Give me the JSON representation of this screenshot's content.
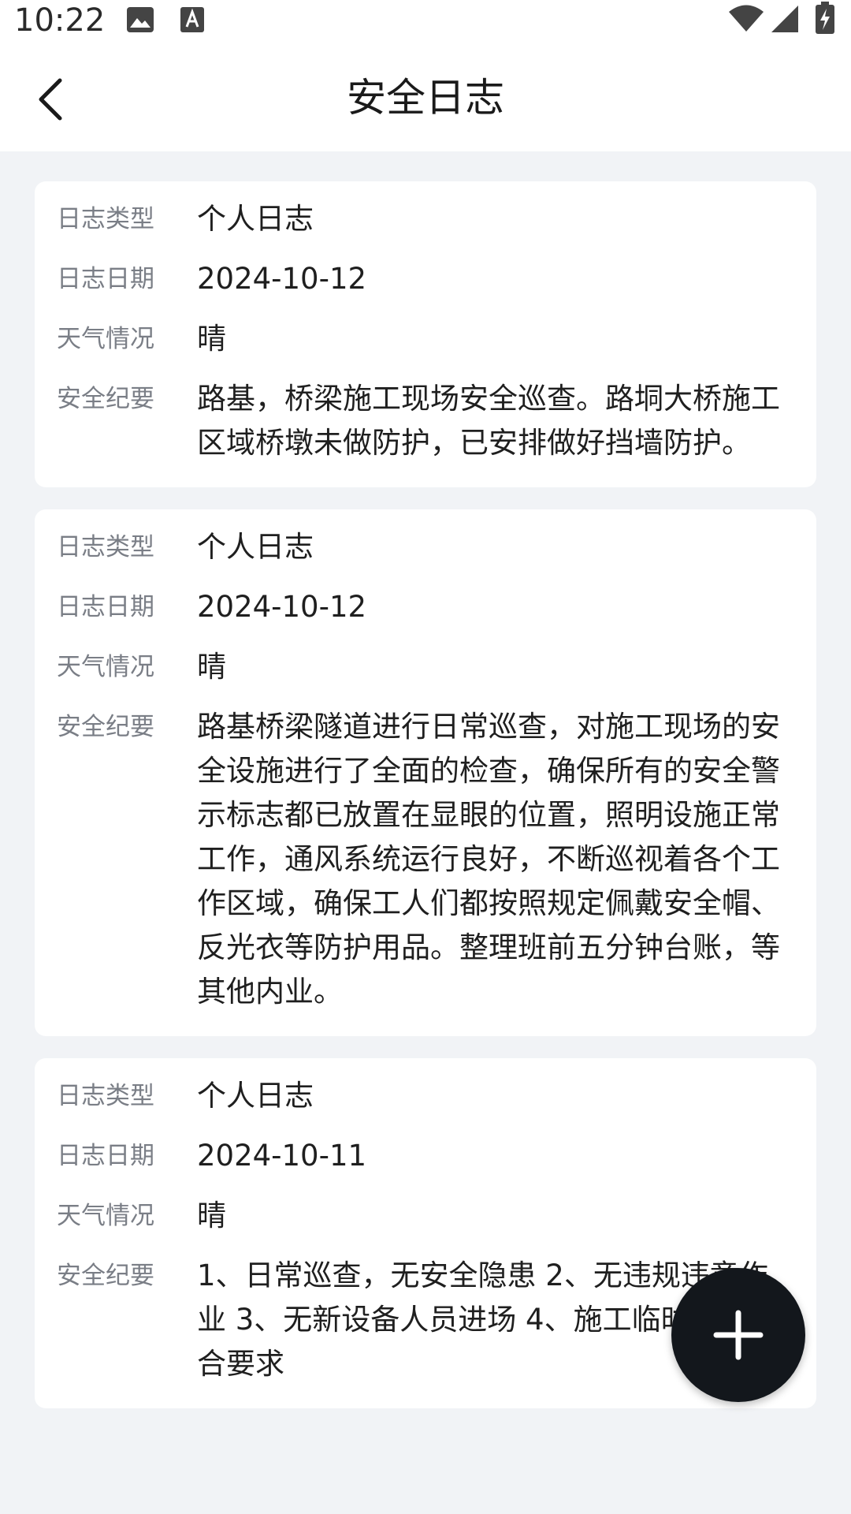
{
  "status_bar": {
    "time": "10:22",
    "icons_left": [
      "image-icon",
      "app-notification-icon"
    ],
    "icons_right": [
      "wifi-icon",
      "signal-icon",
      "battery-charging-icon"
    ]
  },
  "header": {
    "title": "安全日志",
    "back_icon": "chevron-left-icon"
  },
  "logs": [
    {
      "type_label": "日志类型",
      "type": "个人日志",
      "date_label": "日志日期",
      "date": "2024-10-12",
      "weather_label": "天气情况",
      "weather": "晴",
      "summary_label": "安全纪要",
      "summary": "路基，桥梁施工现场安全巡查。路垌大桥施工区域桥墩未做防护，已安排做好挡墙防护。"
    },
    {
      "type_label": "日志类型",
      "type": "个人日志",
      "date_label": "日志日期",
      "date": "2024-10-12",
      "weather_label": "天气情况",
      "weather": "晴",
      "summary_label": "安全纪要",
      "summary": "路基桥梁隧道进行日常巡查，对施工现场的安全设施进行了全面的检查，确保所有的安全警示标志都已放置在显眼的位置，照明设施正常工作，通风系统运行良好，不断巡视着各个工作区域，确保工人们都按照规定佩戴安全帽、反光衣等防护用品。整理班前五分钟台账，等其他内业。"
    },
    {
      "type_label": "日志类型",
      "type": "个人日志",
      "date_label": "日志日期",
      "date": "2024-10-11",
      "weather_label": "天气情况",
      "weather": "晴",
      "summary_label": "安全纪要",
      "summary": "1、日常巡查，无安全隐患 2、无违规违章作业 3、无新设备人员进场 4、施工临时用电符合要求"
    }
  ],
  "fab": {
    "icon": "plus-icon",
    "background": "#13171c"
  },
  "colors": {
    "page_background": "#f1f3f6",
    "card_background": "#ffffff",
    "label": "#7a7e86",
    "value": "#1f1f1f"
  }
}
